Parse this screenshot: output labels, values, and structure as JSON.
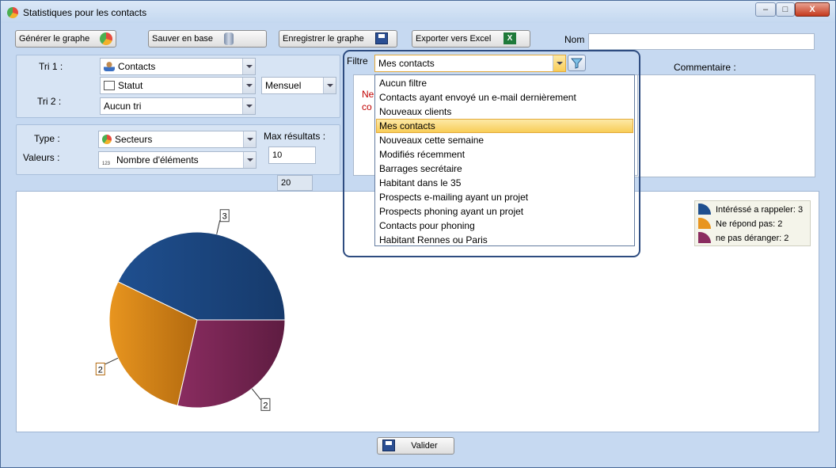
{
  "window": {
    "title": "Statistiques pour les contacts",
    "minimize": "–",
    "maximize": "□",
    "close": "X"
  },
  "toolbar": {
    "generate": "Générer le graphe",
    "save_base": "Sauver en base",
    "save_graph": "Enregistrer le graphe",
    "export_excel": "Exporter vers Excel",
    "name_label": "Nom",
    "name_value": ""
  },
  "sort_panel": {
    "tri1_label": "Tri 1 :",
    "tri1_value": "Contacts",
    "tri1_sub_value": "Statut",
    "period_value": "Mensuel",
    "tri2_label": "Tri 2 :",
    "tri2_value": "Aucun tri"
  },
  "type_panel": {
    "type_label": "Type :",
    "type_value": "Secteurs",
    "values_label": "Valeurs :",
    "values_value": "Nombre d'éléments",
    "max_label": "Max résultats :",
    "max_value": "10",
    "extra_value": "20"
  },
  "filter": {
    "label": "Filtre",
    "selected": "Mes contacts",
    "options": [
      "Aucun filtre",
      "Contacts ayant envoyé un e-mail dernièrement",
      "Nouveaux clients",
      "Mes contacts",
      "Nouveaux cette semaine",
      "Modifiés récemment",
      "Barrages secrétaire",
      "Habitant dans le 35",
      "Prospects e-mailing ayant un projet",
      "Prospects phoning ayant un projet",
      "Contacts pour phoning",
      "Habitant Rennes ou Paris"
    ],
    "selected_index": 3
  },
  "comment": {
    "label": "Commentaire :",
    "hidden_text": "Ne",
    "hidden_text2": "co"
  },
  "chart_data": {
    "type": "pie",
    "categories": [
      "Intéréssé a rappeler",
      "Ne répond pas",
      "ne pas déranger"
    ],
    "values": [
      3,
      2,
      2
    ],
    "legend": [
      "Intéréssé a rappeler: 3",
      "Ne répond pas: 2",
      "ne pas déranger: 2"
    ],
    "data_labels": [
      "3",
      "2",
      "2"
    ],
    "colors": [
      "#1f4f8f",
      "#e8951f",
      "#8a2c60"
    ],
    "legend_position": "top-right"
  },
  "footer": {
    "validate": "Valider"
  }
}
